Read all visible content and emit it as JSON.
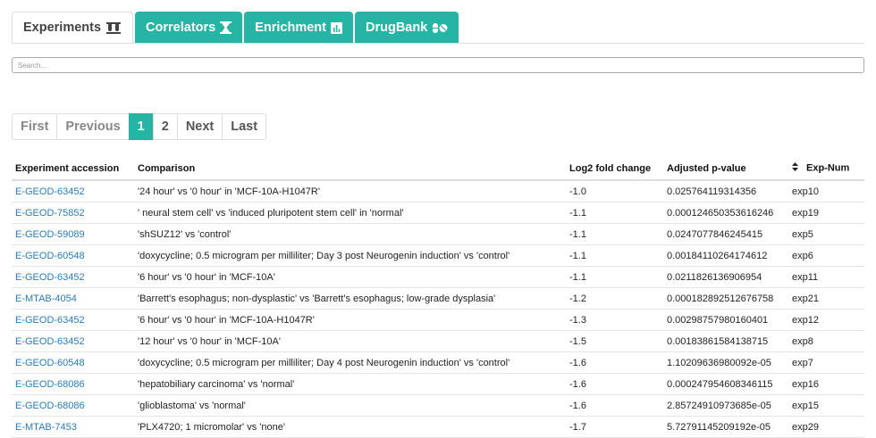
{
  "tabs": [
    {
      "label": "Experiments",
      "icon": "test-tubes-icon",
      "active": true
    },
    {
      "label": "Correlators",
      "icon": "hourglass-icon",
      "active": false
    },
    {
      "label": "Enrichment",
      "icon": "bar-chart-icon",
      "active": false
    },
    {
      "label": "DrugBank",
      "icon": "pills-icon",
      "active": false
    }
  ],
  "search": {
    "placeholder": "Search..."
  },
  "pagination": {
    "first": "First",
    "previous": "Previous",
    "page1": "1",
    "page2": "2",
    "next": "Next",
    "last": "Last",
    "current_page": 1
  },
  "table": {
    "headers": [
      "Experiment accession",
      "Comparison",
      "Log2 fold change",
      "Adjusted p-value",
      "Exp-Num"
    ],
    "rows": [
      [
        "E-GEOD-63452",
        "'24 hour' vs '0 hour' in 'MCF-10A-H1047R'",
        "-1.0",
        "0.025764119314356",
        "exp10"
      ],
      [
        "E-GEOD-75852",
        "' neural stem cell' vs 'induced pluripotent stem cell' in 'normal'",
        "-1.1",
        "0.000124650353616246",
        "exp19"
      ],
      [
        "E-GEOD-59089",
        "'shSUZ12' vs 'control'",
        "-1.1",
        "0.0247077846245415",
        "exp5"
      ],
      [
        "E-GEOD-60548",
        "'doxycycline; 0.5 microgram per milliliter; Day 3 post Neurogenin induction' vs 'control'",
        "-1.1",
        "0.00184110264174612",
        "exp6"
      ],
      [
        "E-GEOD-63452",
        "'6 hour' vs '0 hour' in 'MCF-10A'",
        "-1.1",
        "0.0211826136906954",
        "exp11"
      ],
      [
        "E-MTAB-4054",
        "'Barrett's esophagus; non-dysplastic' vs 'Barrett's esophagus; low-grade dysplasia'",
        "-1.2",
        "0.000182892512676758",
        "exp21"
      ],
      [
        "E-GEOD-63452",
        "'6 hour' vs '0 hour' in 'MCF-10A-H1047R'",
        "-1.3",
        "0.00298757980160401",
        "exp12"
      ],
      [
        "E-GEOD-63452",
        "'12 hour' vs '0 hour' in 'MCF-10A'",
        "-1.5",
        "0.00183861584138715",
        "exp8"
      ],
      [
        "E-GEOD-60548",
        "'doxycycline; 0.5 microgram per milliliter; Day 4 post Neurogenin induction' vs 'control'",
        "-1.6",
        "1.10209636980092e-05",
        "exp7"
      ],
      [
        "E-GEOD-68086",
        "'hepatobiliary carcinoma' vs 'normal'",
        "-1.6",
        "0.000247954608346115",
        "exp16"
      ],
      [
        "E-GEOD-68086",
        "'glioblastoma' vs 'normal'",
        "-1.6",
        "2.85724910973685e-05",
        "exp15"
      ],
      [
        "E-MTAB-7453",
        "'PLX4720; 1 micromolar' vs 'none'",
        "-1.7",
        "5.72791145209192e-05",
        "exp29"
      ]
    ]
  },
  "colors": {
    "accent": "#26b4a4",
    "link": "#2a7ab8"
  }
}
